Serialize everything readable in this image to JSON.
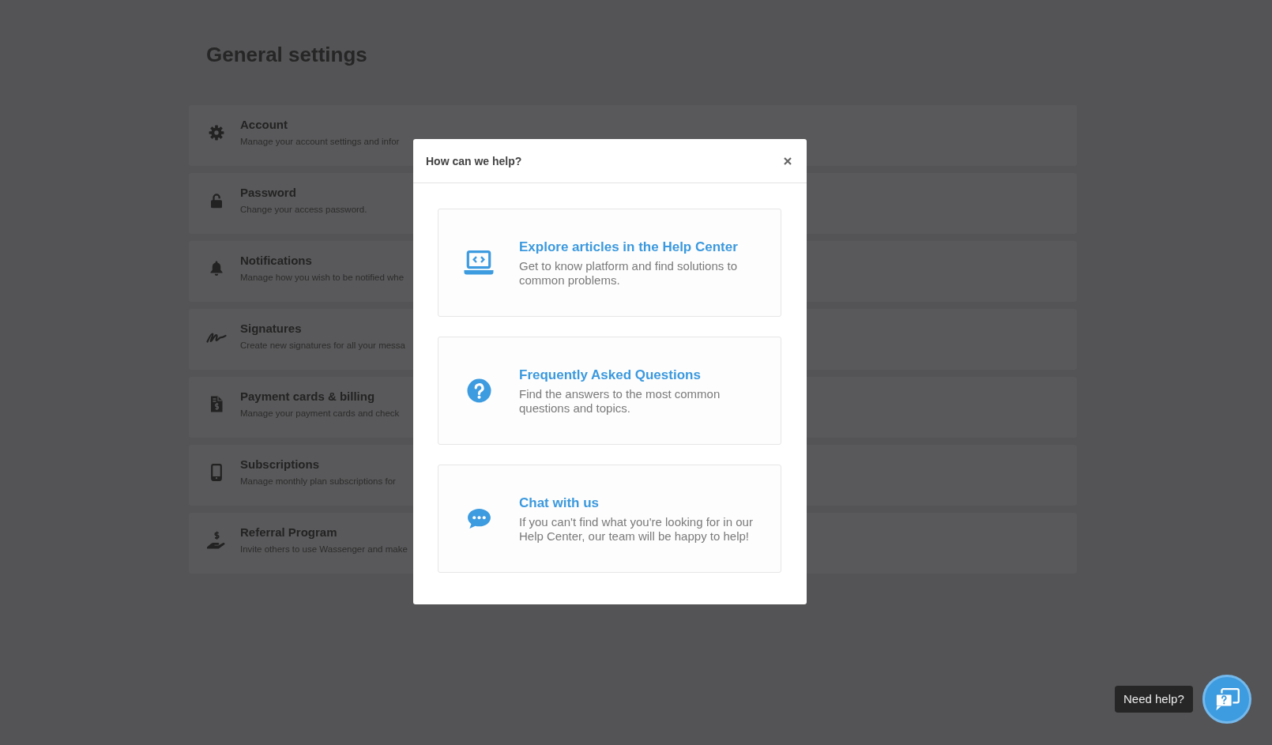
{
  "page": {
    "title": "General settings"
  },
  "settings": [
    {
      "kind": "account",
      "title": "Account",
      "description": "Manage your account settings and infor"
    },
    {
      "kind": "password",
      "title": "Password",
      "description": "Change your access password."
    },
    {
      "kind": "notifications",
      "title": "Notifications",
      "description": "Manage how you wish to be notified whe"
    },
    {
      "kind": "signatures",
      "title": "Signatures",
      "description": "Create new signatures for all your messa"
    },
    {
      "kind": "billing",
      "title": "Payment cards & billing",
      "description": "Manage your payment cards and check"
    },
    {
      "kind": "subscriptions",
      "title": "Subscriptions",
      "description": "Manage monthly plan subscriptions for"
    },
    {
      "kind": "referral",
      "title": "Referral Program",
      "description": "Invite others to use Wassenger and make"
    }
  ],
  "dialog": {
    "title": "How can we help?",
    "options": [
      {
        "kind": "articles",
        "title": "Explore articles in the Help Center",
        "description": "Get to know platform and find solutions to common problems."
      },
      {
        "kind": "faq",
        "title": "Frequently Asked Questions",
        "description": "Find the answers to the most common questions and topics."
      },
      {
        "kind": "chat",
        "title": "Chat with us",
        "description": "If you can't find what you're looking for in our Help Center, our team will be happy to help!"
      }
    ]
  },
  "help_widget": {
    "tooltip": "Need help?"
  }
}
